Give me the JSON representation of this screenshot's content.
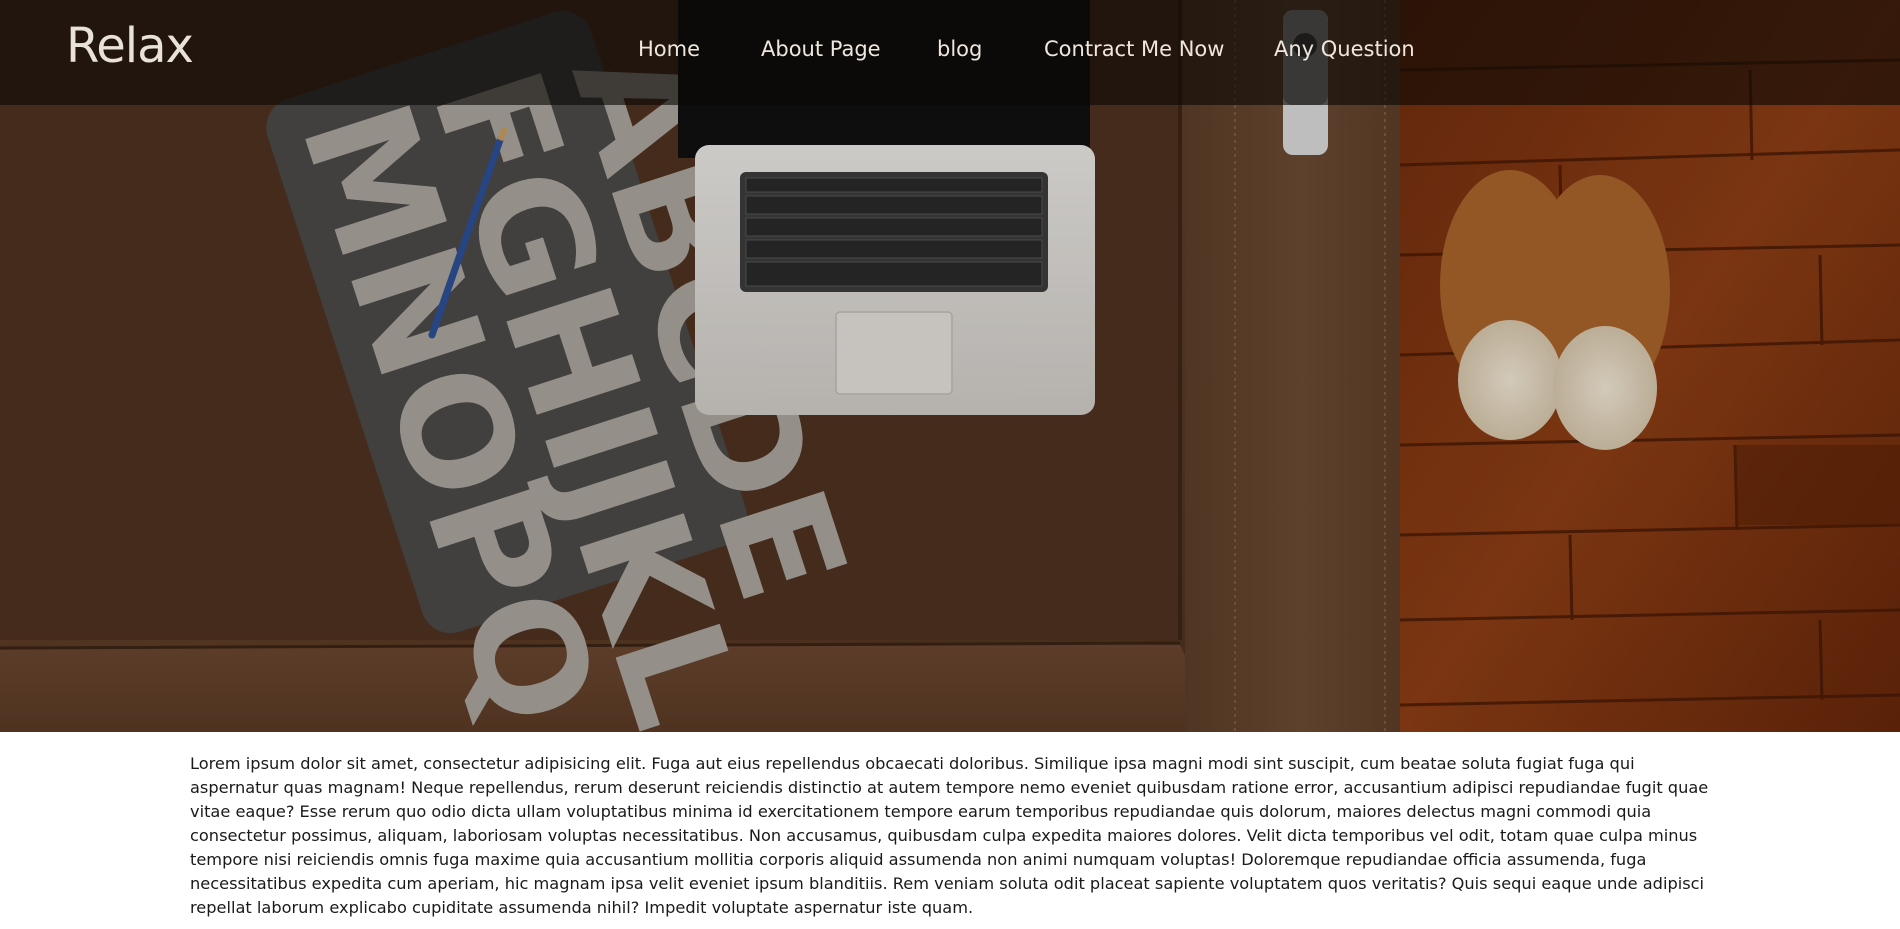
{
  "brand": {
    "name": "Relax"
  },
  "nav": {
    "items": [
      {
        "label": "Home"
      },
      {
        "label": "About Page"
      },
      {
        "label": "blog"
      },
      {
        "label": "Contract Me Now"
      },
      {
        "label": "Any Question"
      }
    ]
  },
  "hero": {
    "pillow_text": "ABCDE FGHIJKL MNOPQ"
  },
  "content": {
    "paragraph": "Lorem ipsum dolor sit amet, consectetur adipisicing elit. Fuga aut eius repellendus obcaecati doloribus. Similique ipsa magni modi sint suscipit, cum beatae soluta fugiat fuga qui aspernatur quas magnam! Neque repellendus, rerum deserunt reiciendis distinctio at autem tempore nemo eveniet quibusdam ratione error, accusantium adipisci repudiandae fugit quae vitae eaque? Esse rerum quo odio dicta ullam voluptatibus minima id exercitationem tempore earum temporibus repudiandae quis dolorum, maiores delectus magni commodi quia consectetur possimus, aliquam, laboriosam voluptas necessitatibus. Non accusamus, quibusdam culpa expedita maiores dolores. Velit dicta temporibus vel odit, totam quae culpa minus tempore nisi reiciendis omnis fuga maxime quia accusantium mollitia corporis aliquid assumenda non animi numquam voluptas! Doloremque repudiandae officia assumenda, fuga necessitatibus expedita cum aperiam, hic magnam ipsa velit eveniet ipsum blanditiis. Rem veniam soluta odit placeat sapiente voluptatem quos veritatis? Quis sequi eaque unde adipisci repellat laborum explicabo cupiditate assumenda nihil? Impedit voluptate aspernatur iste quam."
  }
}
